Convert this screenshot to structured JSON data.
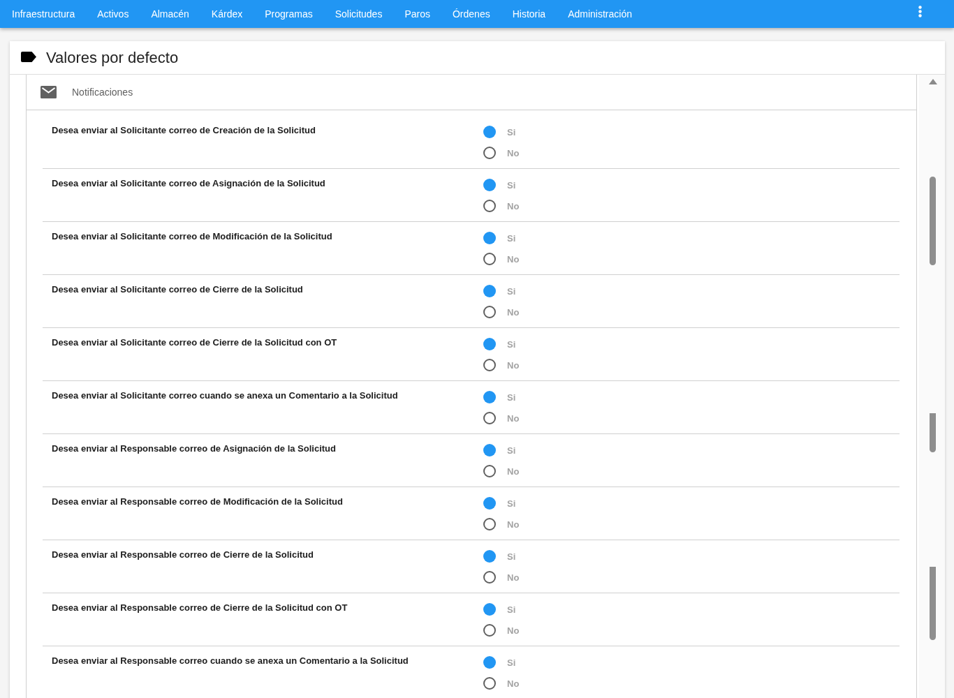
{
  "nav": {
    "items": [
      "Infraestructura",
      "Activos",
      "Almacén",
      "Kárdex",
      "Programas",
      "Solicitudes",
      "Paros",
      "Órdenes",
      "Historia",
      "Administración"
    ]
  },
  "card": {
    "title": "Valores por defecto",
    "section": {
      "title": "Notificaciones",
      "questions": [
        {
          "text": "Desea enviar al Solicitante correo de Creación de la Solicitud",
          "options": [
            {
              "label": "Si",
              "selected": true
            },
            {
              "label": "No",
              "selected": false
            }
          ]
        },
        {
          "text": "Desea enviar al Solicitante correo de Asignación de la Solicitud",
          "options": [
            {
              "label": "Si",
              "selected": true
            },
            {
              "label": "No",
              "selected": false
            }
          ]
        },
        {
          "text": "Desea enviar al Solicitante correo de Modificación de la Solicitud",
          "options": [
            {
              "label": "Si",
              "selected": true
            },
            {
              "label": "No",
              "selected": false
            }
          ]
        },
        {
          "text": "Desea enviar al Solicitante correo de Cierre de la Solicitud",
          "options": [
            {
              "label": "Si",
              "selected": true
            },
            {
              "label": "No",
              "selected": false
            }
          ]
        },
        {
          "text": "Desea enviar al Solicitante correo de Cierre de la Solicitud con OT",
          "options": [
            {
              "label": "Si",
              "selected": true
            },
            {
              "label": "No",
              "selected": false
            }
          ]
        },
        {
          "text": "Desea enviar al Solicitante correo cuando se anexa un Comentario a la Solicitud",
          "options": [
            {
              "label": "Si",
              "selected": true
            },
            {
              "label": "No",
              "selected": false
            }
          ]
        },
        {
          "text": "Desea enviar al Responsable correo de Asignación de la Solicitud",
          "options": [
            {
              "label": "Si",
              "selected": true
            },
            {
              "label": "No",
              "selected": false
            }
          ]
        },
        {
          "text": "Desea enviar al Responsable correo de Modificación de la Solicitud",
          "options": [
            {
              "label": "Si",
              "selected": true
            },
            {
              "label": "No",
              "selected": false
            }
          ]
        },
        {
          "text": "Desea enviar al Responsable correo de Cierre de la Solicitud",
          "options": [
            {
              "label": "Si",
              "selected": true
            },
            {
              "label": "No",
              "selected": false
            }
          ]
        },
        {
          "text": "Desea enviar al Responsable correo de Cierre de la Solicitud con OT",
          "options": [
            {
              "label": "Si",
              "selected": true
            },
            {
              "label": "No",
              "selected": false
            }
          ]
        },
        {
          "text": "Desea enviar al Responsable correo cuando se anexa un Comentario a la Solicitud",
          "options": [
            {
              "label": "Si",
              "selected": true
            },
            {
              "label": "No",
              "selected": false
            }
          ]
        }
      ]
    }
  }
}
